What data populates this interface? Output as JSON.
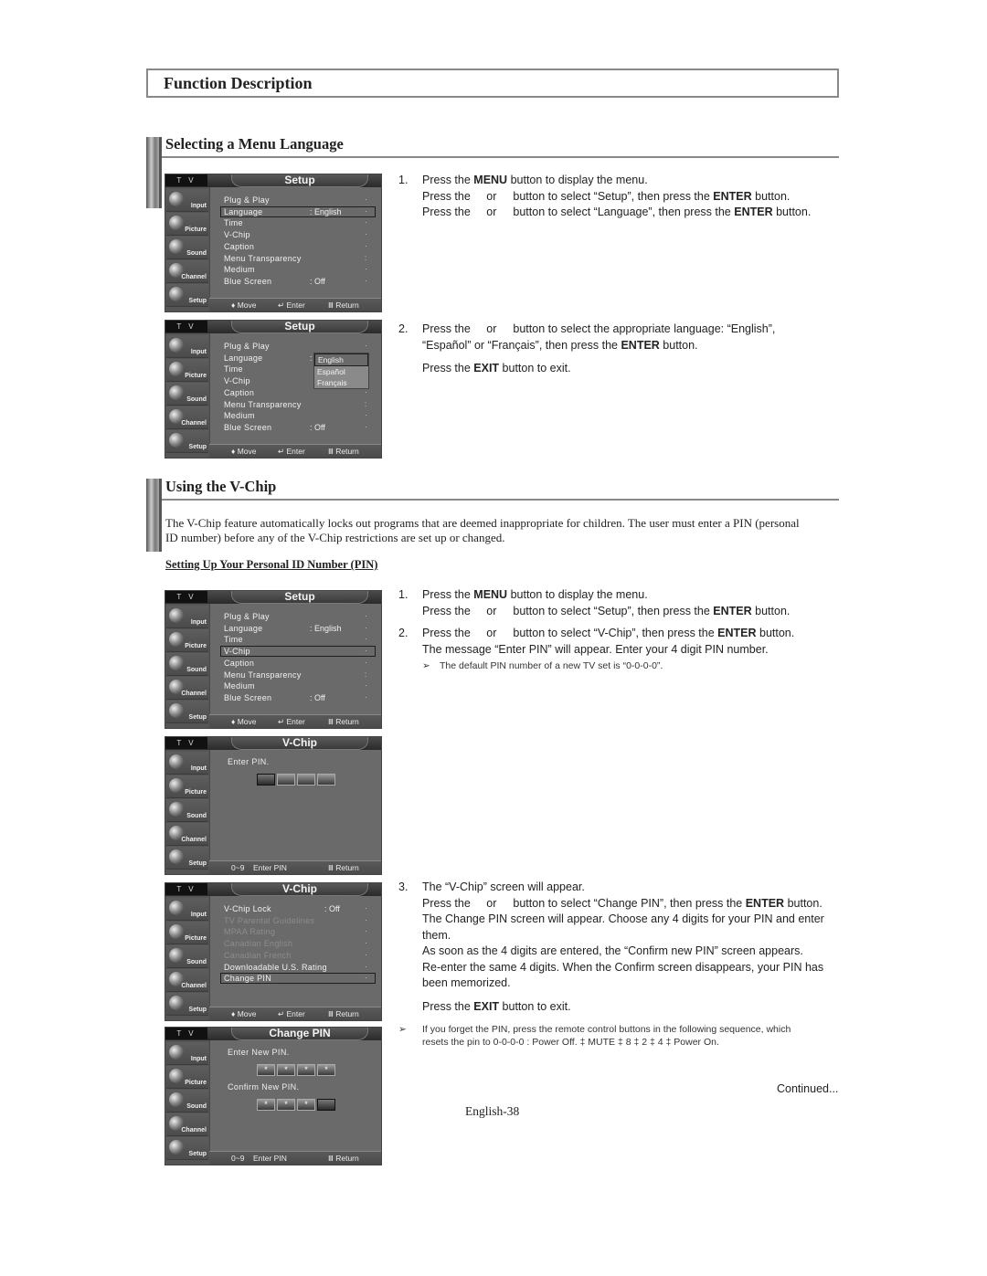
{
  "page": {
    "header_title": "Function Description",
    "page_number": "English-38",
    "continued": "Continued..."
  },
  "section1": {
    "title": "Selecting a Menu Language",
    "steps": [
      {
        "num": "1.",
        "lines": [
          {
            "pre": "Press the ",
            "bold": "MENU",
            "post": " button to display the menu."
          },
          {
            "pre": "Press the ",
            "mid": "or",
            "post1": "button to select “Setup”, then press the ",
            "bold": "ENTER",
            "post": " button."
          },
          {
            "pre": "Press the ",
            "mid": "or",
            "post1": "button to select “Language”, then press the ",
            "bold": "ENTER",
            "post": " button."
          }
        ]
      },
      {
        "num": "2.",
        "lines": [
          {
            "pre": "Press the ",
            "mid": "or",
            "post1": "button to select the appropriate language: “English”,"
          },
          {
            "pre": "“Español” or “Français”, then press the ",
            "bold": "ENTER",
            "post": " button."
          },
          {
            "pre": "Press the ",
            "bold": "EXIT",
            "post": " button to exit."
          }
        ]
      }
    ]
  },
  "section2": {
    "title": "Using the V-Chip",
    "intro_line1": "The V-Chip feature automatically locks out programs that are deemed inappropriate for children. The user must enter a PIN (personal",
    "intro_line2": "ID number) before any of the V-Chip restrictions are set up or changed.",
    "subheading": "Setting Up Your Personal ID Number (PIN)",
    "steps": [
      {
        "num": "1.",
        "lines": [
          {
            "pre": "Press the ",
            "bold": "MENU",
            "post": " button to display the menu."
          },
          {
            "pre": "Press the ",
            "mid": "or",
            "post1": "button to select “Setup”, then press the ",
            "bold": "ENTER",
            "post": " button."
          }
        ]
      },
      {
        "num": "2.",
        "lines": [
          {
            "pre": "Press the ",
            "mid": "or",
            "post1": "button to select “V-Chip”, then press the ",
            "bold": "ENTER",
            "post": " button."
          },
          {
            "pre": "The message “Enter PIN” will appear. Enter your 4 digit PIN number."
          }
        ],
        "note": "The default PIN number of a new TV set is “0-0-0-0”."
      },
      {
        "num": "3.",
        "lines": [
          {
            "pre": "The “V-Chip” screen will appear."
          },
          {
            "pre": "Press the ",
            "mid": "or",
            "post1": "button to select “Change PIN”, then press the ",
            "bold": "ENTER",
            "post": " button."
          },
          {
            "pre": "The Change PIN screen will appear. Choose any 4 digits for your PIN and enter"
          },
          {
            "pre": "them."
          },
          {
            "pre": "As soon as the 4 digits are entered, the “Confirm new PIN” screen appears."
          },
          {
            "pre": "Re-enter the same 4 digits. When the Confirm screen disappears, your PIN has"
          },
          {
            "pre": "been memorized."
          },
          {
            "pre": "Press the ",
            "bold": "EXIT",
            "post": " button to exit."
          }
        ],
        "note_line1": "If you forget the PIN, press the remote control buttons in the following sequence, which",
        "note_line2": "resets the pin to 0-0-0-0 : Power Off. ‡ MUTE ‡ 8 ‡ 2 ‡ 4 ‡ Power On."
      }
    ]
  },
  "osd": {
    "tv_label": "T V",
    "sidebar": [
      "Input",
      "Picture",
      "Sound",
      "Channel",
      "Setup"
    ],
    "sidebar_icons": [
      "input-icon",
      "picture-icon",
      "sound-icon",
      "channel-icon",
      "setup-icon"
    ],
    "footer_move": "♦ Move",
    "footer_enter": "↵ Enter",
    "footer_return": "Ⅲ Return",
    "footer_digits": "0~9",
    "footer_enter_pin": "Enter PIN",
    "setup_title": "Setup",
    "setup_items": [
      {
        "label": "Plug & Play",
        "value": ""
      },
      {
        "label": "Language",
        "value": ": English"
      },
      {
        "label": "Time",
        "value": ""
      },
      {
        "label": "V-Chip",
        "value": ""
      },
      {
        "label": "Caption",
        "value": ""
      },
      {
        "label": "Menu Transparency",
        "value": ""
      },
      {
        "label": "Medium",
        "value": ""
      },
      {
        "label": "Blue Screen",
        "value": ": Off"
      }
    ],
    "language_options": [
      "English",
      "Español",
      "Français"
    ],
    "language_selected": "English",
    "vchip_title": "V-Chip",
    "enter_pin_label": "Enter PIN.",
    "vchip_items": [
      {
        "label": "V-Chip Lock",
        "value": ": Off",
        "enabled": true
      },
      {
        "label": "TV Parental Guidelines",
        "value": "",
        "enabled": false
      },
      {
        "label": "MPAA Rating",
        "value": "",
        "enabled": false
      },
      {
        "label": "Canadian English",
        "value": "",
        "enabled": false
      },
      {
        "label": "Canadian French",
        "value": "",
        "enabled": false
      },
      {
        "label": "Downloadable U.S. Rating",
        "value": "",
        "enabled": true
      },
      {
        "label": "Change PIN",
        "value": "",
        "enabled": true
      }
    ],
    "change_pin_title": "Change PIN",
    "enter_new_pin_label": "Enter New PIN.",
    "confirm_new_pin_label": "Confirm New PIN.",
    "pin_mask": "*",
    "enter_new_pin_filled": 4,
    "confirm_new_pin_filled": 3
  }
}
